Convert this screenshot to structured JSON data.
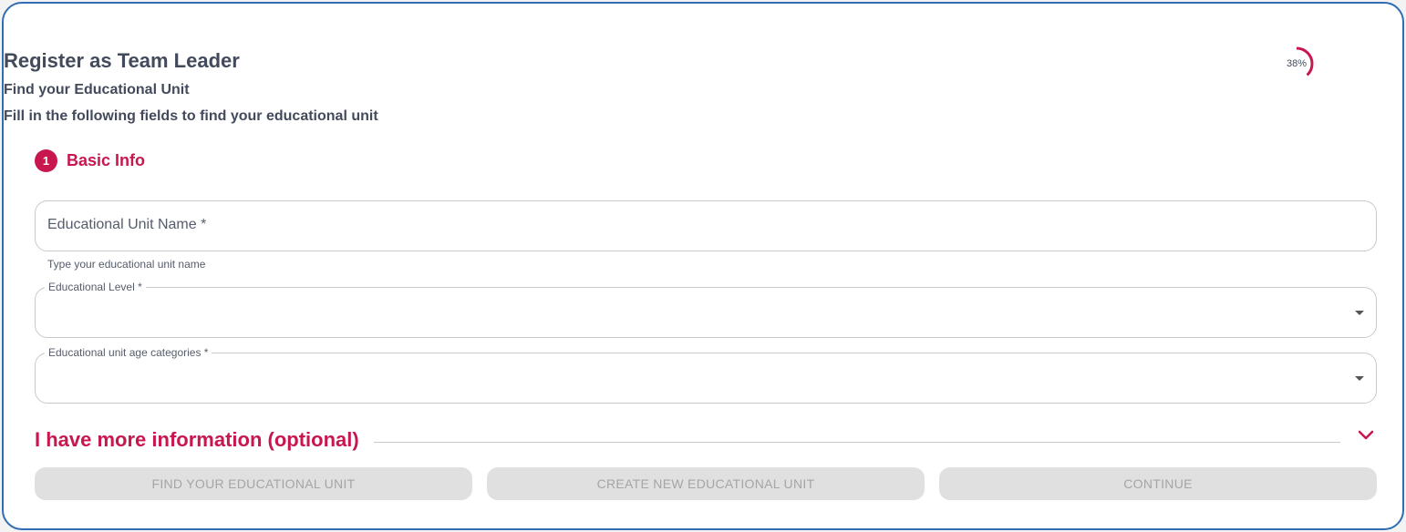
{
  "header": {
    "title": "Register as Team Leader",
    "subtitle": "Find your Educational Unit",
    "instruction": "Fill in the following fields to find your educational unit"
  },
  "progress": {
    "value": 0.38,
    "label": "38%",
    "color": "#c8174f"
  },
  "step": {
    "number": "1",
    "label": "Basic Info"
  },
  "fields": {
    "unit_name": {
      "label": "Educational Unit Name *",
      "helper": "Type your educational unit name",
      "value": ""
    },
    "level": {
      "label": "Educational Level *",
      "value": ""
    },
    "age_categories": {
      "label": "Educational unit age categories *",
      "value": ""
    }
  },
  "more_info": {
    "label": "I have more information (optional)",
    "icon": "chevron-down-icon"
  },
  "buttons": {
    "find": "FIND YOUR EDUCATIONAL UNIT",
    "create": "CREATE NEW EDUCATIONAL UNIT",
    "continue": "CONTINUE"
  },
  "colors": {
    "accent": "#c8174f",
    "border": "#2f6db5",
    "disabled_bg": "#e0e0e0",
    "disabled_text": "#a5a5a5"
  }
}
